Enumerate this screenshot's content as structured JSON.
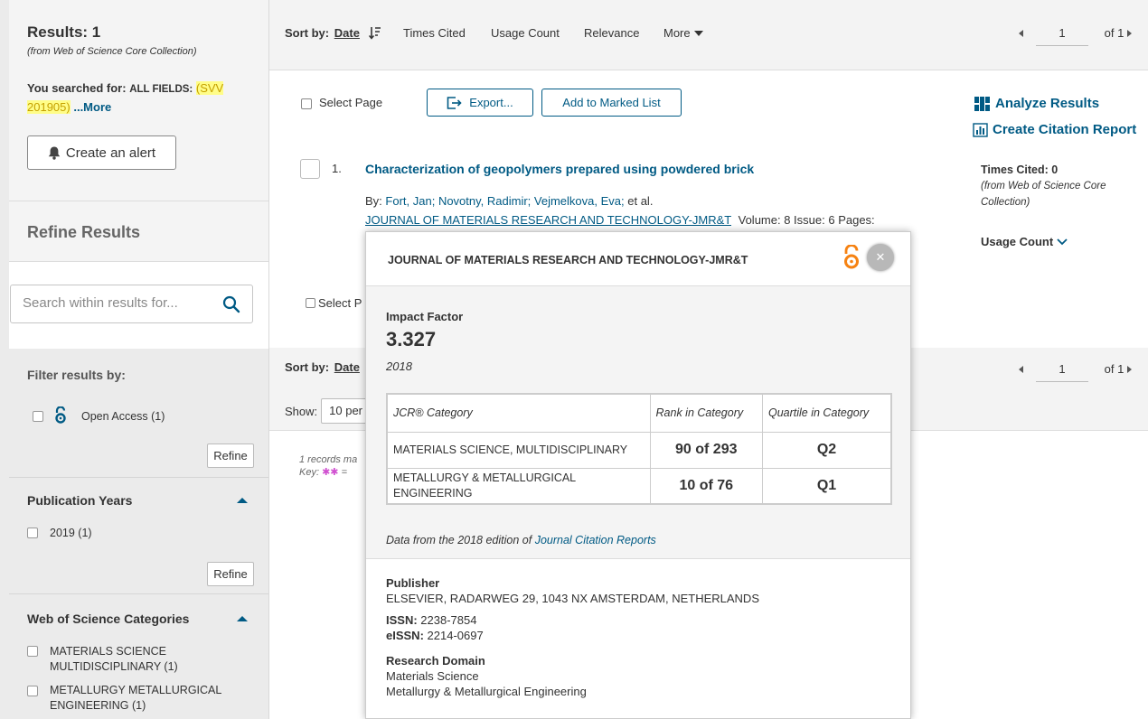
{
  "sidebar": {
    "results_title": "Results: 1",
    "results_source": "(from Web of Science Core Collection)",
    "searched_prefix": "You searched for:",
    "searched_field": "ALL FIELDS:",
    "searched_query": "(SVV 201905)",
    "more_link": "...More",
    "create_alert": "Create an alert",
    "refine_title": "Refine Results",
    "search_placeholder": "Search within results for...",
    "filter_title": "Filter results by:",
    "open_access": "Open Access (1)",
    "refine_label": "Refine",
    "pub_years_title": "Publication Years",
    "pub_year_item": "2019 (1)",
    "wos_categories_title": "Web of Science Categories",
    "cat1_line1": "MATERIALS SCIENCE",
    "cat1_line2": "MULTIDISCIPLINARY (1)",
    "cat2_line1": "METALLURGY METALLURGICAL",
    "cat2_line2": "ENGINEERING (1)"
  },
  "sort": {
    "label": "Sort by:",
    "date": "Date",
    "times_cited": "Times Cited",
    "usage_count": "Usage Count",
    "relevance": "Relevance",
    "more": "More",
    "page": "1",
    "of_pages": "of 1"
  },
  "toolbar": {
    "select_page": "Select Page",
    "export": "Export...",
    "add_marked": "Add to Marked List",
    "analyze": "Analyze Results",
    "citation_report": "Create Citation Report"
  },
  "record": {
    "number": "1.",
    "title": "Characterization of geopolymers prepared using powdered brick",
    "by_label": "By:",
    "authors": "Fort, Jan; Novotny, Radimir; Vejmelkova, Eva;",
    "et_al": "et al.",
    "journal": "JOURNAL OF MATERIALS RESEARCH AND TECHNOLOGY-JMR&T",
    "volume_issue": "Volume: 8  Issue: 6  Pages:",
    "times_cited": "Times Cited: 0",
    "times_cited_source": "(from Web of Science Core Collection)",
    "usage_count": "Usage Count"
  },
  "lower": {
    "select_page": "Select P",
    "sort_label": "Sort by:",
    "sort_date": "Date",
    "show_label": "Show:",
    "show_value": "10 per",
    "records_matched": "1 records ma",
    "key_label": "Key:"
  },
  "popup": {
    "journal": "JOURNAL OF MATERIALS RESEARCH AND TECHNOLOGY-JMR&T",
    "impact_factor_label": "Impact Factor",
    "impact_factor": "3.327",
    "year": "2018",
    "table_headers": [
      "JCR® Category",
      "Rank in Category",
      "Quartile in Category"
    ],
    "rows": [
      {
        "category": "MATERIALS SCIENCE, MULTIDISCIPLINARY",
        "rank": "90 of 293",
        "quartile": "Q2"
      },
      {
        "category": "METALLURGY & METALLURGICAL ENGINEERING",
        "rank": "10 of 76",
        "quartile": "Q1"
      }
    ],
    "data_from_prefix": "Data from the 2018 edition of",
    "data_from_link": "Journal Citation Reports",
    "publisher_label": "Publisher",
    "publisher": "ELSEVIER, RADARWEG 29, 1043 NX AMSTERDAM, NETHERLANDS",
    "issn_label": "ISSN:",
    "issn": "2238-7854",
    "eissn_label": "eISSN:",
    "eissn": "2214-0697",
    "research_domain_label": "Research Domain",
    "domain1": "Materials Science",
    "domain2": "Metallurgy & Metallurgical Engineering"
  },
  "colors": {
    "link": "#005a84",
    "highlight": "#fffd88",
    "open_access": "#f68212"
  }
}
